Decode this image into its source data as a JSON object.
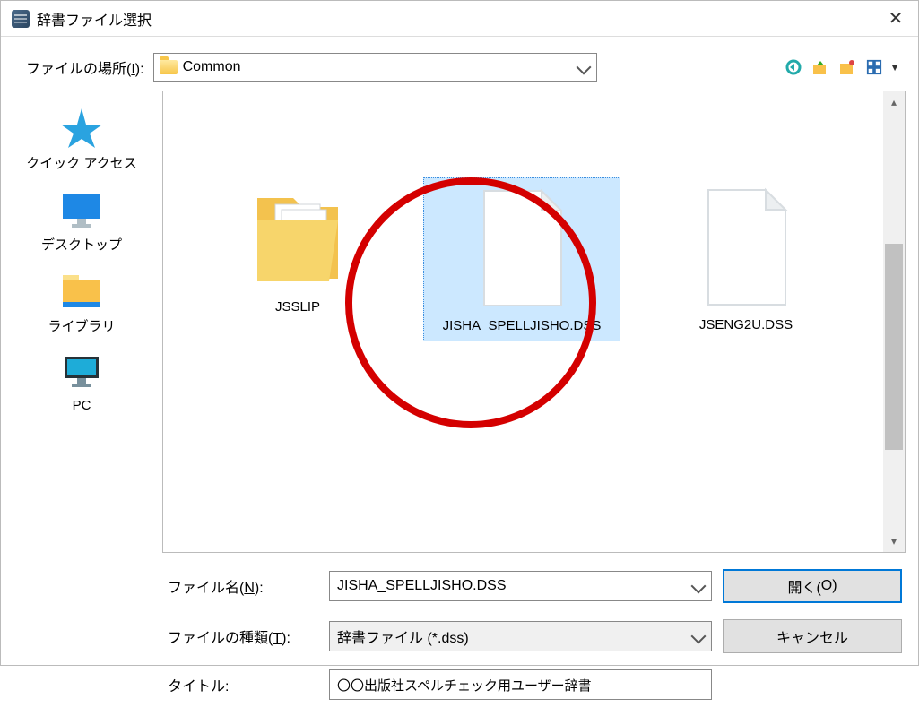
{
  "window": {
    "title": "辞書ファイル選択"
  },
  "location": {
    "label_pre": "ファイルの場所(",
    "label_key": "I",
    "label_post": "):",
    "value": "Common"
  },
  "places": {
    "quick": "クイック アクセス",
    "desktop": "デスクトップ",
    "library": "ライブラリ",
    "pc": "PC"
  },
  "items": [
    {
      "name": "JSSLIP",
      "type": "folder",
      "selected": false
    },
    {
      "name": "JISHA_SPELLJISHO.DSS",
      "type": "file",
      "selected": true
    },
    {
      "name": "JSENG2U.DSS",
      "type": "file",
      "selected": false
    }
  ],
  "filename": {
    "label_pre": "ファイル名(",
    "label_key": "N",
    "label_post": "):",
    "value": "JISHA_SPELLJISHO.DSS"
  },
  "filetype": {
    "label_pre": "ファイルの種類(",
    "label_key": "T",
    "label_post": "):",
    "value": "辞書ファイル (*.dss)"
  },
  "title": {
    "label": "タイトル:",
    "value": "〇〇出版社スペルチェック用ユーザー辞書"
  },
  "buttons": {
    "open_pre": "開く(",
    "open_key": "O",
    "open_post": ")",
    "cancel": "キャンセル"
  }
}
